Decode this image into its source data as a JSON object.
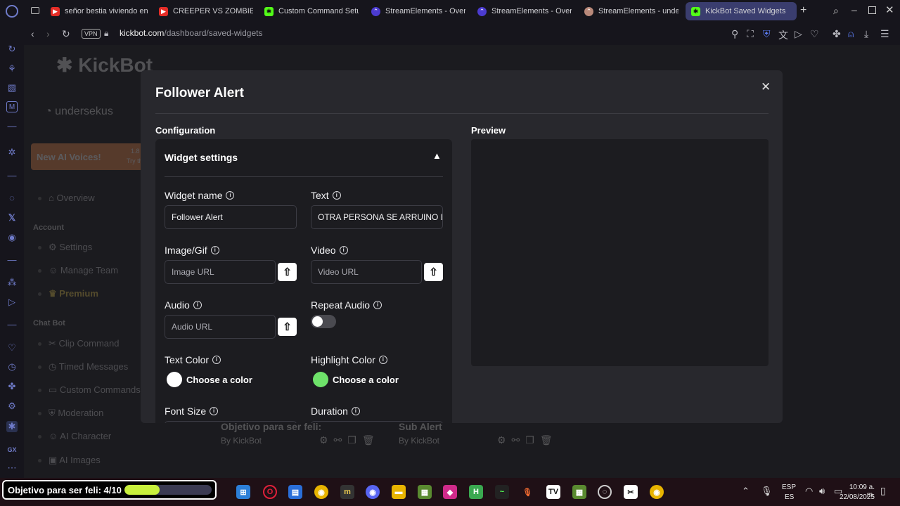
{
  "browser": {
    "tabs": [
      {
        "label": "señor bestia viviendo en",
        "icon": "youtube-icon"
      },
      {
        "label": "CREEPER VS ZOMBIE | ",
        "icon": "youtube-icon"
      },
      {
        "label": "Custom Command Setu",
        "icon": "kickbot-icon"
      },
      {
        "label": "StreamElements - Over",
        "icon": "streamelements-icon"
      },
      {
        "label": "StreamElements - Over",
        "icon": "streamelements-icon"
      },
      {
        "label": "StreamElements - unde",
        "icon": "streamelements-icon"
      },
      {
        "label": "KickBot Saved Widgets",
        "icon": "kickbot-icon"
      }
    ],
    "vpn_label": "VPN",
    "url_domain": "kickbot.com",
    "url_path": "/dashboard/saved-widgets"
  },
  "background_page": {
    "logo": "KickBot",
    "username": "undersekus",
    "promo_title": "New AI Voices!",
    "promo_side_1": "1.8",
    "promo_side_2": "Try th",
    "nav": {
      "overview": "Overview",
      "account_header": "Account",
      "settings": "Settings",
      "manage_team": "Manage Team",
      "premium": "Premium",
      "chatbot_header": "Chat Bot",
      "clip_command": "Clip Command",
      "timed_messages": "Timed Messages",
      "custom_commands": "Custom Commands",
      "moderation": "Moderation",
      "ai_character": "AI Character",
      "ai_images": "AI Images"
    },
    "cards": [
      {
        "title": "Objetivo para ser feli:",
        "by": "By KickBot"
      },
      {
        "title": "Sub Alert",
        "by": "By KickBot"
      }
    ]
  },
  "modal": {
    "title": "Follower Alert",
    "configuration_label": "Configuration",
    "preview_label": "Preview",
    "widget_settings_label": "Widget settings",
    "fields": {
      "widget_name_label": "Widget name",
      "widget_name_value": "Follower Alert",
      "text_label": "Text",
      "text_value": "OTRA PERSONA SE ARRUINO LA VIDA",
      "image_label": "Image/Gif",
      "image_placeholder": "Image URL",
      "video_label": "Video",
      "video_placeholder": "Video URL",
      "audio_label": "Audio",
      "audio_placeholder": "Audio URL",
      "repeat_audio_label": "Repeat Audio",
      "repeat_audio_on": false,
      "text_color_label": "Text Color",
      "text_color_value": "#ffffff",
      "text_color_button": "Choose a color",
      "highlight_color_label": "Highlight Color",
      "highlight_color_value": "#6ee26a",
      "highlight_color_button": "Choose a color",
      "font_size_label": "Font Size",
      "duration_label": "Duration"
    }
  },
  "taskbar": {
    "goal_label": "Objetivo para ser feli: 4/10",
    "goal_progress": 0.4,
    "goal_color": "#c8f03c",
    "lang_1": "ESP",
    "lang_2": "ES",
    "time": "10:09 a. m.",
    "date": "22/08/2025"
  }
}
